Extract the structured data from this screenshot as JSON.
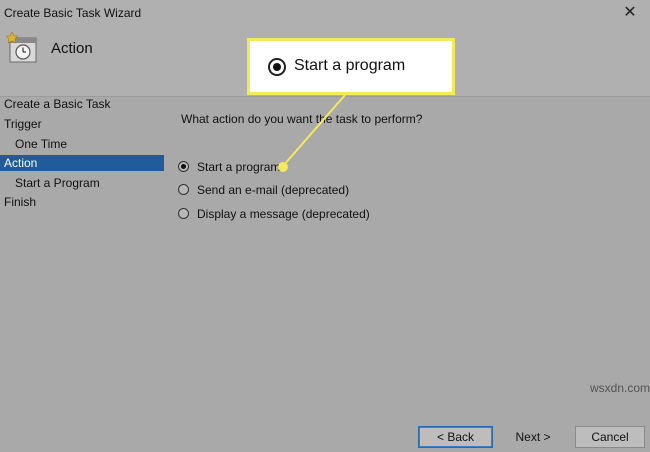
{
  "window": {
    "title": "Create Basic Task Wizard",
    "close_glyph": "✕"
  },
  "header": {
    "title": "Action",
    "icon": "task-clock-icon"
  },
  "nav": {
    "items": [
      {
        "label": "Create a Basic Task",
        "active": false
      },
      {
        "label": "Trigger",
        "active": false
      },
      {
        "label": "One Time",
        "active": false
      },
      {
        "label": "Action",
        "active": true
      },
      {
        "label": "Start a Program",
        "active": false
      },
      {
        "label": "Finish",
        "active": false
      }
    ]
  },
  "main": {
    "question": "What action do you want the task to perform?",
    "options": [
      {
        "label": "Start a program",
        "checked": true
      },
      {
        "label": "Send an e-mail (deprecated)",
        "checked": false
      },
      {
        "label": "Display a message (deprecated)",
        "checked": false
      }
    ]
  },
  "buttons": {
    "back": "< Back",
    "next": "Next >",
    "cancel": "Cancel"
  },
  "callout": {
    "label": "Start a program"
  },
  "watermark": "wsxdn.com",
  "colors": {
    "accent": "#1f5c99",
    "callout_border": "#f3e95b",
    "overlay_gray": "#a9a9a9"
  }
}
